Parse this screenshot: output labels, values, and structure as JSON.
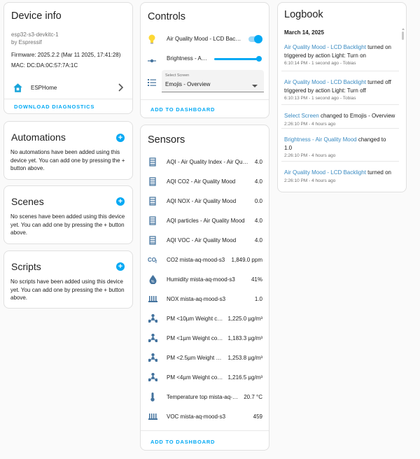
{
  "device_info": {
    "title": "Device info",
    "model": "esp32-s3-devkitc-1",
    "manufacturer": "by Espressif",
    "firmware": "Firmware: 2025.2.2 (Mar 11 2025, 17:41:28)",
    "mac": "MAC: DC:DA:0C:57:7A:1C",
    "integration": "ESPHome",
    "download": "DOWNLOAD DIAGNOSTICS"
  },
  "automations": {
    "title": "Automations",
    "empty": "No automations have been added using this device yet. You can add one by pressing the + button above."
  },
  "scenes": {
    "title": "Scenes",
    "empty": "No scenes have been added using this device yet. You can add one by pressing the + button above."
  },
  "scripts": {
    "title": "Scripts",
    "empty": "No scripts have been added using this device yet. You can add one by pressing the + button above."
  },
  "controls": {
    "title": "Controls",
    "light_name": "Air Quality Mood - LCD Bac…",
    "light_on": true,
    "brightness_name": "Brightness - A…",
    "brightness_level": 1.0,
    "select_label": "Select Screen",
    "select_value": "Emojis - Overview",
    "add_dashboard": "ADD TO DASHBOARD"
  },
  "sensors": {
    "title": "Sensors",
    "add_dashboard": "ADD TO DASHBOARD",
    "items": [
      {
        "name": "AQI - Air Quality Index - Air Qua…",
        "value": "4.0",
        "icon": "gauge-icon"
      },
      {
        "name": "AQI CO2 - Air Quality Mood",
        "value": "4.0",
        "icon": "gauge-icon"
      },
      {
        "name": "AQI NOX - Air Quality Mood",
        "value": "0.0",
        "icon": "gauge-icon"
      },
      {
        "name": "AQI particles - Air Quality Mood",
        "value": "4.0",
        "icon": "gauge-icon"
      },
      {
        "name": "AQI VOC - Air Quality Mood",
        "value": "4.0",
        "icon": "gauge-icon"
      },
      {
        "name": "CO2 mista-aq-mood-s3",
        "value": "1,849.0 ppm",
        "icon": "co2-icon"
      },
      {
        "name": "Humidity mista-aq-mood-s3",
        "value": "41%",
        "icon": "water-percent-icon"
      },
      {
        "name": "NOX mista-aq-mood-s3",
        "value": "1.0",
        "icon": "radiator-icon"
      },
      {
        "name": "PM <10µm Weight c…",
        "value": "1,225.0 µg/m³",
        "icon": "molecule-icon"
      },
      {
        "name": "PM <1µm Weight co…",
        "value": "1,183.3 µg/m³",
        "icon": "molecule-icon"
      },
      {
        "name": "PM <2.5µm Weight …",
        "value": "1,253.8 µg/m³",
        "icon": "molecule-icon"
      },
      {
        "name": "PM <4µm Weight co…",
        "value": "1,216.5 µg/m³",
        "icon": "molecule-icon"
      },
      {
        "name": "Temperature top mista-aq-…",
        "value": "20.7 °C",
        "icon": "thermometer-icon"
      },
      {
        "name": "VOC mista-aq-mood-s3",
        "value": "459",
        "icon": "radiator-icon"
      }
    ]
  },
  "logbook": {
    "title": "Logbook",
    "date": "March 14, 2025",
    "entries": [
      {
        "link": "Air Quality Mood - LCD Backlight",
        "text1": " turned on",
        "text2": "triggered by action Light: Turn on",
        "meta": "6:10:14 PM - 1 second ago - Tobias"
      },
      {
        "link": "Air Quality Mood - LCD Backlight",
        "text1": " turned off",
        "text2": "triggered by action Light: Turn off",
        "meta": "6:10:13 PM - 1 second ago - Tobias"
      },
      {
        "link": "Select Screen",
        "text1": " changed to Emojis - Overview",
        "text2": "",
        "meta": "2:26:10 PM - 4 hours ago"
      },
      {
        "link": "Brightness - Air Quality Mood",
        "text1": " changed to",
        "text2": "1.0",
        "meta": "2:26:10 PM - 4 hours ago"
      },
      {
        "link": "Air Quality Mood - LCD Backlight",
        "text1": " turned on",
        "text2": "",
        "meta": "2:26:10 PM - 4 hours ago"
      }
    ]
  },
  "colors": {
    "accent": "#03a9f4",
    "link": "#3a8bc2",
    "icon": "#44739e",
    "lightbulb": "#fdd835"
  }
}
